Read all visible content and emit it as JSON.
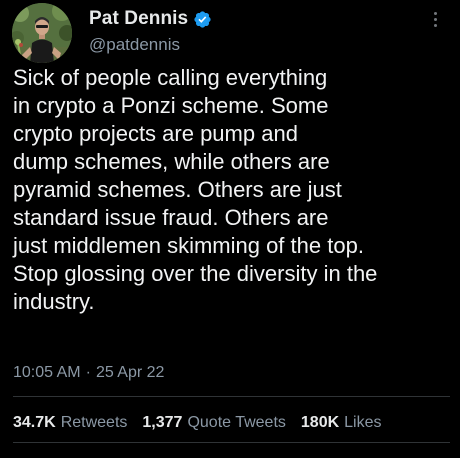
{
  "author": {
    "display_name": "Pat Dennis",
    "handle": "@patdennis",
    "verified": true,
    "avatar_icon": "profile-photo",
    "verified_icon": "verified-badge-icon"
  },
  "tweet": {
    "lines": [
      "Sick of people calling everything",
      "in crypto a Ponzi scheme. Some",
      "crypto projects are pump and",
      "dump schemes, while others are",
      "pyramid schemes. Others are just",
      "standard issue fraud. Others are",
      "just middlemen skimming of the top.",
      "Stop glossing over the diversity in the",
      "industry."
    ],
    "time": "10:05 AM",
    "separator": "·",
    "date": "25 Apr 22"
  },
  "stats": {
    "retweets_count": "34.7K",
    "retweets_label": "Retweets",
    "quotes_count": "1,377",
    "quotes_label": "Quote Tweets",
    "likes_count": "180K",
    "likes_label": "Likes"
  },
  "colors": {
    "background": "#000000",
    "primary_text": "#e7e9ea",
    "secondary_text": "#8b98a5",
    "verified_blue": "#1d9bf0",
    "divider": "#2f3336"
  }
}
